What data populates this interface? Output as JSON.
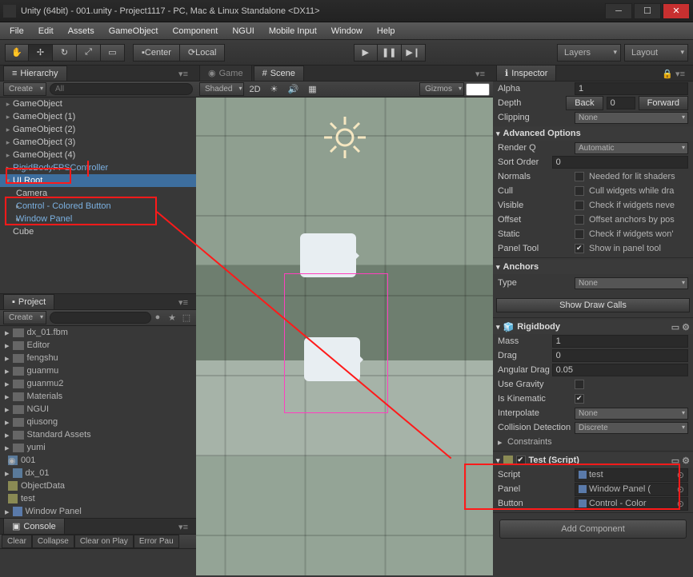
{
  "window": {
    "title": "Unity (64bit) - 001.unity - Project1117 - PC, Mac & Linux Standalone <DX11>"
  },
  "menu": {
    "items": [
      "File",
      "Edit",
      "Assets",
      "GameObject",
      "Component",
      "NGUI",
      "Mobile Input",
      "Window",
      "Help"
    ]
  },
  "toolbar": {
    "center": "Center",
    "local": "Local",
    "layers": "Layers",
    "layout": "Layout"
  },
  "tabs": {
    "hierarchy": "Hierarchy",
    "project": "Project",
    "console": "Console",
    "game": "Game",
    "scene": "Scene",
    "inspector": "Inspector"
  },
  "hierarchy": {
    "create": "Create",
    "searchHint": "All",
    "items": [
      {
        "name": "GameObject",
        "expandable": true
      },
      {
        "name": "GameObject (1)",
        "expandable": true
      },
      {
        "name": "GameObject (2)",
        "expandable": true
      },
      {
        "name": "GameObject (3)",
        "expandable": true
      },
      {
        "name": "GameObject (4)",
        "expandable": true
      },
      {
        "name": "RigidBodyFPSController",
        "link": true,
        "expandable": true
      },
      {
        "name": "UI Root",
        "sel": true,
        "expandable": true,
        "open": true
      },
      {
        "name": "Camera",
        "indent": 1
      },
      {
        "name": "Control - Colored Button",
        "indent": 1,
        "link": true,
        "expandable": true
      },
      {
        "name": "Window Panel",
        "indent": 1,
        "link": true,
        "expandable": true
      },
      {
        "name": "Cube",
        "indent": 0
      }
    ]
  },
  "project": {
    "create": "Create",
    "items": [
      {
        "name": "dx_01.fbm",
        "type": "folder",
        "exp": true
      },
      {
        "name": "Editor",
        "type": "folder",
        "exp": true
      },
      {
        "name": "fengshu",
        "type": "folder",
        "exp": true
      },
      {
        "name": "guanmu",
        "type": "folder",
        "exp": true
      },
      {
        "name": "guanmu2",
        "type": "folder",
        "exp": true
      },
      {
        "name": "Materials",
        "type": "folder",
        "exp": true
      },
      {
        "name": "NGUI",
        "type": "folder",
        "exp": true
      },
      {
        "name": "qiusong",
        "type": "folder",
        "exp": true
      },
      {
        "name": "Standard Assets",
        "type": "folder",
        "exp": true
      },
      {
        "name": "yumi",
        "type": "folder",
        "exp": true
      },
      {
        "name": "001",
        "type": "scene"
      },
      {
        "name": "dx_01",
        "type": "mesh"
      },
      {
        "name": "ObjectData",
        "type": "cs"
      },
      {
        "name": "test",
        "type": "cs"
      },
      {
        "name": "Window Panel",
        "type": "prefab"
      }
    ]
  },
  "console": {
    "clear": "Clear",
    "collapse": "Collapse",
    "clearplay": "Clear on Play",
    "errpause": "Error Pau"
  },
  "scene": {
    "shaded": "Shaded",
    "twoD": "2D",
    "gizmos": "Gizmos"
  },
  "inspector": {
    "alpha": "Alpha",
    "alphaVal": "1",
    "depth": "Depth",
    "back": "Back",
    "depthVal": "0",
    "forward": "Forward",
    "clipping": "Clipping",
    "clippingVal": "None",
    "advanced": "Advanced Options",
    "renderq": "Render Q",
    "renderqVal": "Automatic",
    "sortorder": "Sort Order",
    "sortorderVal": "0",
    "normals": "Normals",
    "normalsHint": "Needed for lit shaders",
    "cull": "Cull",
    "cullHint": "Cull widgets while dra",
    "visible": "Visible",
    "visibleHint": "Check if widgets neve",
    "offset": "Offset",
    "offsetHint": "Offset anchors by pos",
    "static": "Static",
    "staticHint": "Check if widgets won'",
    "paneltool": "Panel Tool",
    "paneltoolHint": "Show in panel tool",
    "anchors": "Anchors",
    "type": "Type",
    "typeVal": "None",
    "drawcalls": "Show Draw Calls",
    "rigidbody": "Rigidbody",
    "mass": "Mass",
    "massVal": "1",
    "drag": "Drag",
    "dragVal": "0",
    "angdrag": "Angular Drag",
    "angdragVal": "0.05",
    "usegrav": "Use Gravity",
    "iskin": "Is Kinematic",
    "interp": "Interpolate",
    "interpVal": "None",
    "coldet": "Collision Detection",
    "coldetVal": "Discrete",
    "constraints": "Constraints",
    "test": "Test (Script)",
    "script": "Script",
    "scriptVal": "test",
    "panel": "Panel",
    "panelVal": "Window Panel (",
    "button": "Button",
    "buttonVal": "Control - Color",
    "addcomp": "Add Component"
  }
}
